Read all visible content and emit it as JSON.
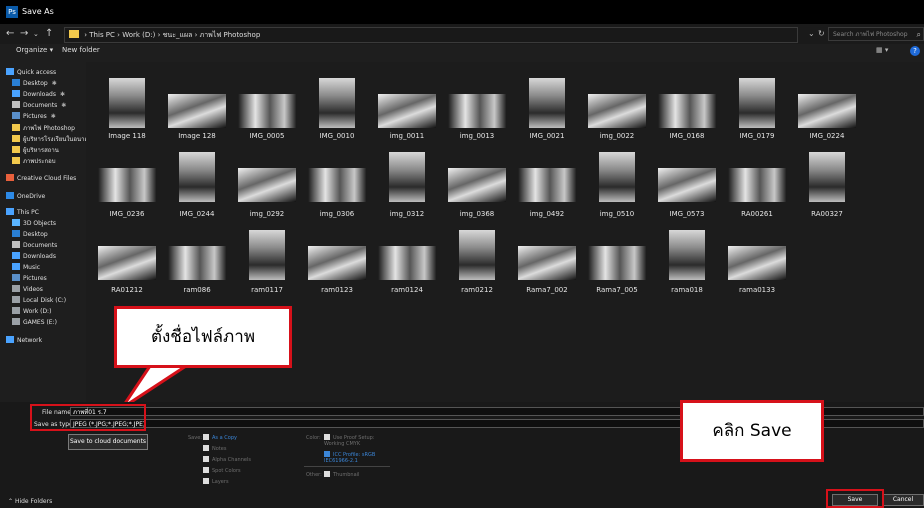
{
  "window": {
    "title": "Save As",
    "app_icon": "Ps"
  },
  "address": {
    "path": [
      "This PC",
      "Work (D:)",
      "ชนะ_แผล",
      "ภาพไฟ Photoshop"
    ],
    "search_placeholder": "Search ภาพไฟ Photoshop"
  },
  "toolbar": {
    "organize": "Organize",
    "new_folder": "New folder"
  },
  "sidebar": {
    "items": [
      {
        "label": "Quick access",
        "icon": "star-icon",
        "color": "#4aa3ff"
      },
      {
        "label": "Desktop",
        "icon": "desktop-icon",
        "color": "#2a7fd4",
        "pinned": true
      },
      {
        "label": "Downloads",
        "icon": "download-icon",
        "color": "#4aa3ff",
        "pinned": true
      },
      {
        "label": "Documents",
        "icon": "documents-icon",
        "color": "#c0c0c0",
        "pinned": true
      },
      {
        "label": "Pictures",
        "icon": "pictures-icon",
        "color": "#5a8fc9",
        "pinned": true
      },
      {
        "label": "ภาพไฟ Photoshop",
        "icon": "folder-icon",
        "color": "#f2c94c"
      },
      {
        "label": "ผู้บริหารโรงเรียนในอนาค",
        "icon": "folder-icon",
        "color": "#f2c94c"
      },
      {
        "label": "ผู้บริหารสถาน",
        "icon": "folder-icon",
        "color": "#f2c94c"
      },
      {
        "label": "ภาพประกอบ",
        "icon": "folder-icon",
        "color": "#f2c94c"
      },
      {
        "label": "Creative Cloud Files",
        "icon": "creative-cloud-icon",
        "color": "#e8603c"
      },
      {
        "label": "OneDrive",
        "icon": "onedrive-icon",
        "color": "#2d8ae6"
      },
      {
        "label": "This PC",
        "icon": "computer-icon",
        "color": "#4aa3ff"
      },
      {
        "label": "3D Objects",
        "icon": "cube-icon",
        "color": "#5ab4ff"
      },
      {
        "label": "Desktop",
        "icon": "desktop-icon",
        "color": "#2a7fd4"
      },
      {
        "label": "Documents",
        "icon": "documents-icon",
        "color": "#c0c0c0"
      },
      {
        "label": "Downloads",
        "icon": "download-icon",
        "color": "#4aa3ff"
      },
      {
        "label": "Music",
        "icon": "music-icon",
        "color": "#4aa3ff"
      },
      {
        "label": "Pictures",
        "icon": "pictures-icon",
        "color": "#5a8fc9"
      },
      {
        "label": "Videos",
        "icon": "video-icon",
        "color": "#9aa0a6"
      },
      {
        "label": "Local Disk (C:)",
        "icon": "drive-icon",
        "color": "#9aa0a6"
      },
      {
        "label": "Work (D:)",
        "icon": "drive-icon",
        "color": "#9aa0a6"
      },
      {
        "label": "GAMES (E:)",
        "icon": "drive-icon",
        "color": "#9aa0a6"
      },
      {
        "label": "Network",
        "icon": "network-icon",
        "color": "#4aa3ff"
      }
    ]
  },
  "files": [
    "Image 118",
    "Image 128",
    "IMG_0005",
    "IMG_0010",
    "img_0011",
    "img_0013",
    "IMG_0021",
    "img_0022",
    "IMG_0168",
    "IMG_0179",
    "IMG_0224",
    "IMG_0236",
    "IMG_0244",
    "img_0292",
    "img_0306",
    "img_0312",
    "img_0368",
    "img_0492",
    "img_0510",
    "IMG_0573",
    "RA00261",
    "RA00327",
    "RA01212",
    "ram086",
    "ram0117",
    "ram0123",
    "ram0124",
    "ram0212",
    "Rama7_002",
    "Rama7_005",
    "rama018",
    "rama0133"
  ],
  "callouts": {
    "name_file": "ตั้งชื่อไฟล์ภาพ",
    "click_save": "คลิก Save"
  },
  "form": {
    "file_name_label": "File name:",
    "file_name_value": "ภาพที่01 ร.7",
    "save_type_label": "Save as type:",
    "save_type_value": "JPEG (*.JPG;*.JPEG;*.JPE)",
    "cloud_button": "Save to cloud documents",
    "save_group": {
      "label": "Save:",
      "as_copy": "As a Copy",
      "notes": "Notes",
      "alpha": "Alpha Channels",
      "spot": "Spot Colors",
      "layers": "Layers"
    },
    "color_group": {
      "label": "Color:",
      "proof": "Use Proof Setup: Working CMYK",
      "icc": "ICC Profile: sRGB IEC61966-2.1"
    },
    "other_group": {
      "label": "Other:",
      "thumbnail": "Thumbnail"
    }
  },
  "buttons": {
    "save": "Save",
    "cancel": "Cancel",
    "hide_folders": "Hide Folders"
  },
  "colors": {
    "accent_red": "#d6111a",
    "link_blue": "#3b86d8"
  }
}
